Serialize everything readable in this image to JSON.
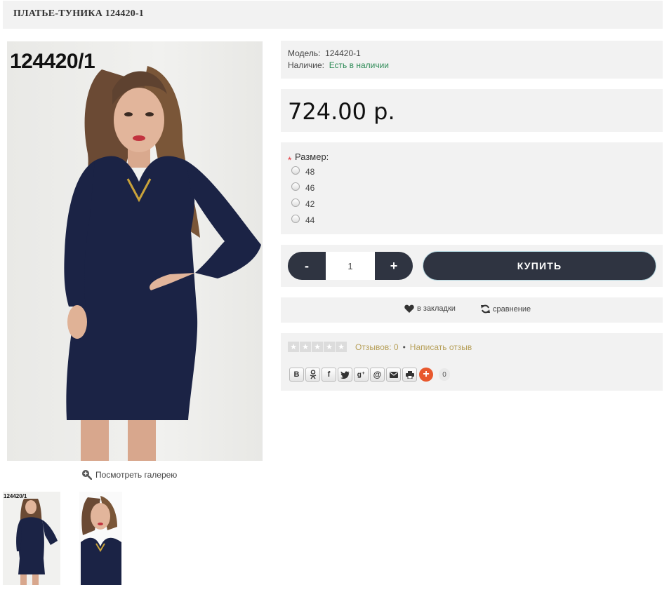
{
  "product": {
    "title": "ПЛАТЬЕ-ТУНИКА 124420-1",
    "photo_code": "124420/1",
    "model_label": "Модель:",
    "model_value": "124420-1",
    "availability_label": "Наличие:",
    "availability_value": "Есть в наличии",
    "price": "724.00 р."
  },
  "gallery": {
    "link_label": "Посмотреть галерею",
    "thumb_code": "124420/1"
  },
  "options": {
    "required_mark": "*",
    "size_label": "Размер:",
    "sizes": [
      "48",
      "46",
      "42",
      "44"
    ]
  },
  "cart": {
    "minus_label": "-",
    "plus_label": "+",
    "quantity": "1",
    "buy_label": "КУПИТЬ"
  },
  "actions": {
    "wishlist_label": "в закладки",
    "compare_label": "сравнение"
  },
  "reviews": {
    "stars_filled": 0,
    "stars_total": 5,
    "count_label": "Отзывов: 0",
    "separator": "•",
    "write_label": "Написать отзыв"
  },
  "share": {
    "buttons": [
      {
        "icon": "vk-icon",
        "glyph": "B"
      },
      {
        "icon": "odnoklassniki-icon",
        "glyph": "ok"
      },
      {
        "icon": "facebook-icon",
        "glyph": "f"
      },
      {
        "icon": "twitter-icon",
        "glyph": "tw"
      },
      {
        "icon": "google-plus-icon",
        "glyph": "g+"
      },
      {
        "icon": "mail-ru-icon",
        "glyph": "@"
      },
      {
        "icon": "email-icon",
        "glyph": "✉"
      },
      {
        "icon": "print-icon",
        "glyph": "⎙"
      }
    ],
    "count": "0"
  },
  "colors": {
    "dark_button": "#2f3441",
    "panel_bg": "#f2f2f2",
    "in_stock": "#2e8b57",
    "review_link": "#b7a05a",
    "required": "#e3363c",
    "share_plus": "#e8582d"
  }
}
